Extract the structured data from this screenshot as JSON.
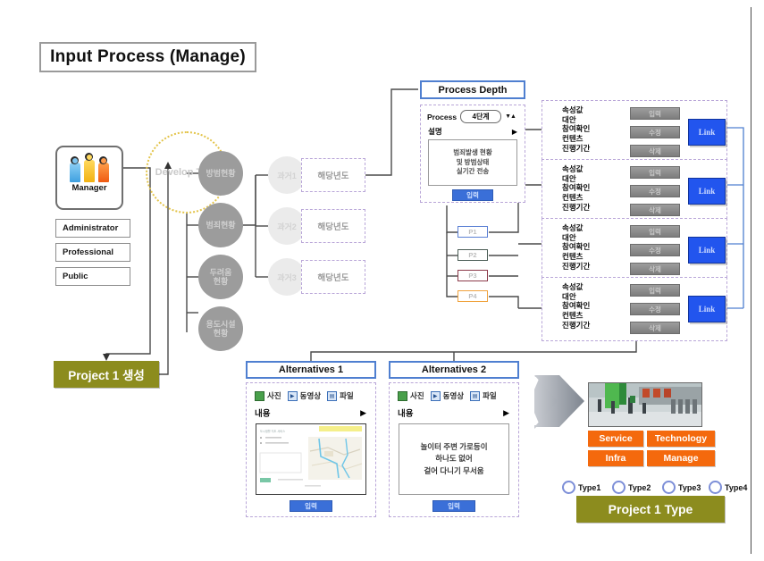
{
  "page": {
    "title": "Input Process (Manage)",
    "accent_blue": "#4f7fd0",
    "accent_orange": "#f4690d",
    "accent_olive": "#8c8c1e",
    "dashed_purple": "#b9a6d8"
  },
  "manager": {
    "label": "Manager",
    "icon": "people-icon",
    "roles": [
      "Administrator",
      "Professional",
      "Public"
    ],
    "project_create": "Project 1 생성"
  },
  "develop": {
    "label": "Develop Type",
    "categories": [
      "방범현황",
      "범죄현황",
      "두려움\n현황",
      "용도시설\n현황"
    ],
    "category_lines": [
      [
        "방범현황"
      ],
      [
        "범죄현황"
      ],
      [
        "두려움",
        "현황"
      ],
      [
        "용도시설",
        "현황"
      ]
    ]
  },
  "past": {
    "rows": [
      {
        "circle": "과거1",
        "box": "해당년도"
      },
      {
        "circle": "과거2",
        "box": "해당년도"
      },
      {
        "circle": "과거3",
        "box": "해당년도"
      }
    ]
  },
  "process_depth": {
    "header": "Process Depth",
    "process_label": "Process",
    "process_value": "4단계",
    "spinner": "▼▲",
    "desc_label": "설명",
    "desc_arrow": "▶",
    "desc_lines": [
      "범죄발생 현황",
      "및 방범상태",
      "실기간 전송"
    ],
    "submit_label": "입력"
  },
  "p_boxes": [
    {
      "label": "P1",
      "color": "#5a7fd4"
    },
    {
      "label": "P2",
      "color": "#4a5c55"
    },
    {
      "label": "P3",
      "color": "#8c3a4a"
    },
    {
      "label": "P4",
      "color": "#f0a23c"
    }
  ],
  "attribute_panel": {
    "labels": [
      "속성값",
      "대안",
      "참여확인",
      "컨텐츠",
      "진행기간"
    ],
    "buttons": [
      "입력",
      "수정",
      "삭제"
    ],
    "link_label": "Link",
    "count": 4
  },
  "alternatives": [
    {
      "header": "Alternatives 1",
      "icons": [
        {
          "name": "photo-icon",
          "label": "사진",
          "glyph": "▰"
        },
        {
          "name": "video-icon",
          "label": "동영상",
          "glyph": "▶"
        },
        {
          "name": "file-icon",
          "label": "파일",
          "glyph": "▤"
        }
      ],
      "content_label": "내용",
      "content_arrow": "▶",
      "media_type": "map-screenshot",
      "body_lines": [],
      "submit_label": "입력"
    },
    {
      "header": "Alternatives 2",
      "icons": [
        {
          "name": "photo-icon",
          "label": "사진",
          "glyph": "▰"
        },
        {
          "name": "video-icon",
          "label": "동영상",
          "glyph": "▶"
        },
        {
          "name": "file-icon",
          "label": "파일",
          "glyph": "▤"
        }
      ],
      "content_label": "내용",
      "content_arrow": "▶",
      "media_type": "text",
      "body_lines": [
        "놀이터 주변 가로등이",
        "하나도 없어",
        "걸어 다니기 무서움"
      ],
      "submit_label": "입력"
    }
  ],
  "project_type": {
    "photo_alt": "street-photo",
    "categories": [
      "Service",
      "Technology",
      "Infra",
      "Manage"
    ],
    "types": [
      "Type1",
      "Type2",
      "Type3",
      "Type4"
    ],
    "result_label": "Project 1 Type"
  }
}
